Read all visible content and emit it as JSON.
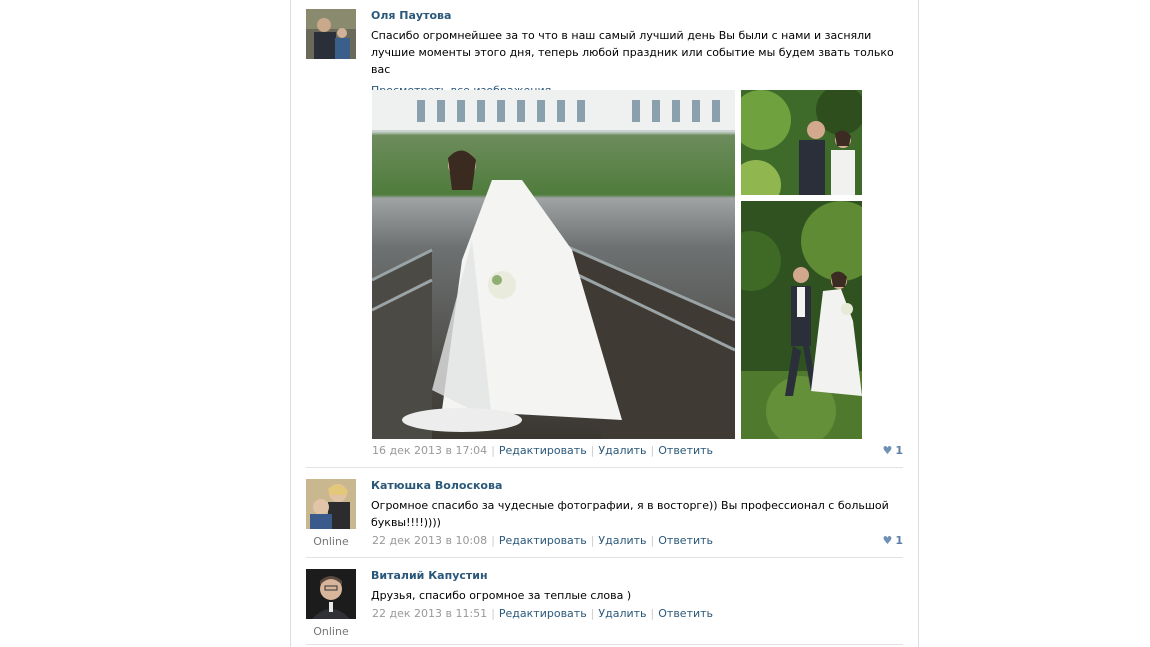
{
  "comments": [
    {
      "author": "Оля Паутова",
      "text": "Спасибо огромнейшее за то что в наш самый лучший день Вы были с нами и засняли лучшие моменты этого дня, теперь любой праздник или событие мы будем звать только вас",
      "view_all_images": "Просмотреть все изображения",
      "date": "16 дек 2013 в 17:04",
      "actions": [
        "Редактировать",
        "Удалить",
        "Ответить"
      ],
      "likes": "1",
      "photos": [
        "bride-on-bridge-photo",
        "couple-kiss-photo",
        "couple-walking-photo"
      ]
    },
    {
      "author": "Катюшка Волоскова",
      "status": "Online",
      "text": "Огромное спасибо за чудесные фотографии, я в восторге)) Вы профессионал с большой буквы!!!!))))",
      "date": "22 дек 2013 в 10:08",
      "actions": [
        "Редактировать",
        "Удалить",
        "Ответить"
      ],
      "likes": "1"
    },
    {
      "author": "Виталий Капустин",
      "status": "Online",
      "text": "Друзья, спасибо огромное за теплые слова )",
      "date": "22 дек 2013 в 11:51",
      "actions": [
        "Редактировать",
        "Удалить",
        "Ответить"
      ]
    }
  ],
  "icons": {
    "like": "heart-icon"
  },
  "colors": {
    "link": "#2b587a",
    "meta": "#999999",
    "like": "#5b7fa6"
  }
}
